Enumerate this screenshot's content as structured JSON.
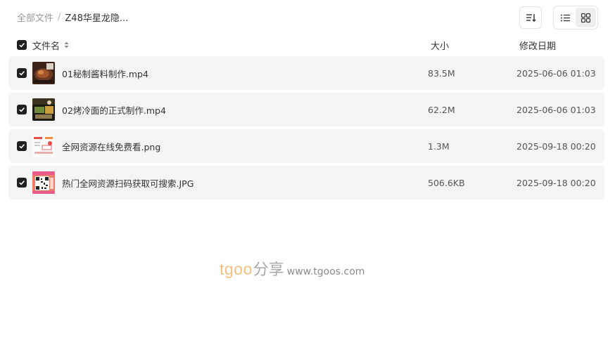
{
  "breadcrumb": {
    "root": "全部文件",
    "separator": "/",
    "current": "Z48华星龙隐..."
  },
  "toolbar": {
    "sort_icon": "sort-list-icon",
    "list_view_icon": "list-view-icon",
    "grid_view_icon": "grid-view-icon",
    "active_view": "list"
  },
  "table": {
    "headers": {
      "name": "文件名",
      "size": "大小",
      "date": "修改日期"
    },
    "all_selected": true,
    "rows": [
      {
        "name": "01秘制酱料制作.mp4",
        "size": "83.5M",
        "date": "2025-06-06 01:03",
        "thumb": "video-thumbnail-sauce",
        "selected": true
      },
      {
        "name": "02烤冷面的正式制作.mp4",
        "size": "62.2M",
        "date": "2025-06-06 01:03",
        "thumb": "video-thumbnail-cold-noodle",
        "selected": true
      },
      {
        "name": "全网资源在线免费看.png",
        "size": "1.3M",
        "date": "2025-09-18 00:20",
        "thumb": "image-thumbnail-poster",
        "selected": true
      },
      {
        "name": "热门全网资源扫码获取可搜索.JPG",
        "size": "506.6KB",
        "date": "2025-09-18 00:20",
        "thumb": "image-thumbnail-qrcode",
        "selected": true
      }
    ]
  },
  "watermark": {
    "brand": "tgoo",
    "share": "分享",
    "url": "www.tgoos.com"
  },
  "colors": {
    "row_bg": "#f4f4f4",
    "checkbox": "#1f1f1f",
    "watermark_brand": "#f3c07f"
  }
}
